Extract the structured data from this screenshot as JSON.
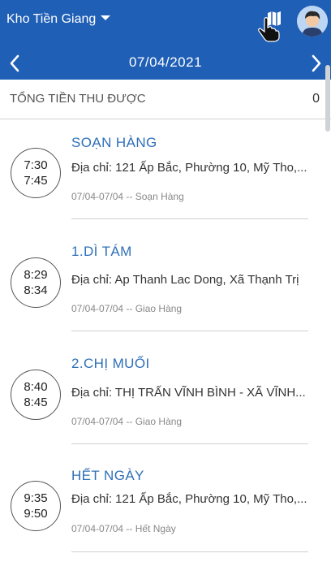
{
  "header": {
    "warehouse": "Kho Tiền Giang",
    "date": "07/04/2021"
  },
  "summary": {
    "label": "TỔNG TIỀN THU ĐƯỢC",
    "value": "0"
  },
  "items": [
    {
      "start": "7:30",
      "end": "7:45",
      "title": "SOẠN HÀNG",
      "address": "Địa chỉ: 121 Ấp Bắc, Phường 10, Mỹ Tho,...",
      "meta": "07/04-07/04 -- Soạn Hàng"
    },
    {
      "start": "8:29",
      "end": "8:34",
      "title": "1.DÌ TÁM",
      "address": "Địa chỉ: Ap Thanh Lac Dong, Xã Thạnh Trị",
      "meta": "07/04-07/04 -- Giao Hàng"
    },
    {
      "start": "8:40",
      "end": "8:45",
      "title": "2.CHỊ  MUỐI",
      "address": "Địa chỉ: THỊ TRẤN VĨNH BÌNH - XÃ VĨNH...",
      "meta": "07/04-07/04 -- Giao Hàng"
    },
    {
      "start": "9:35",
      "end": "9:50",
      "title": "HẾT NGÀY",
      "address": "Địa chỉ: 121 Ấp Bắc, Phường 10, Mỹ Tho,...",
      "meta": "07/04-07/04 -- Hết Ngày"
    }
  ],
  "icons": {
    "dropdown": "caret-down-icon",
    "map": "map-icon",
    "cursor": "hand-pointer-icon",
    "avatar": "user-avatar",
    "prev": "chevron-left-icon",
    "next": "chevron-right-icon"
  },
  "colors": {
    "header_bg": "#1f5fb5",
    "title_blue": "#2f6fb8"
  }
}
